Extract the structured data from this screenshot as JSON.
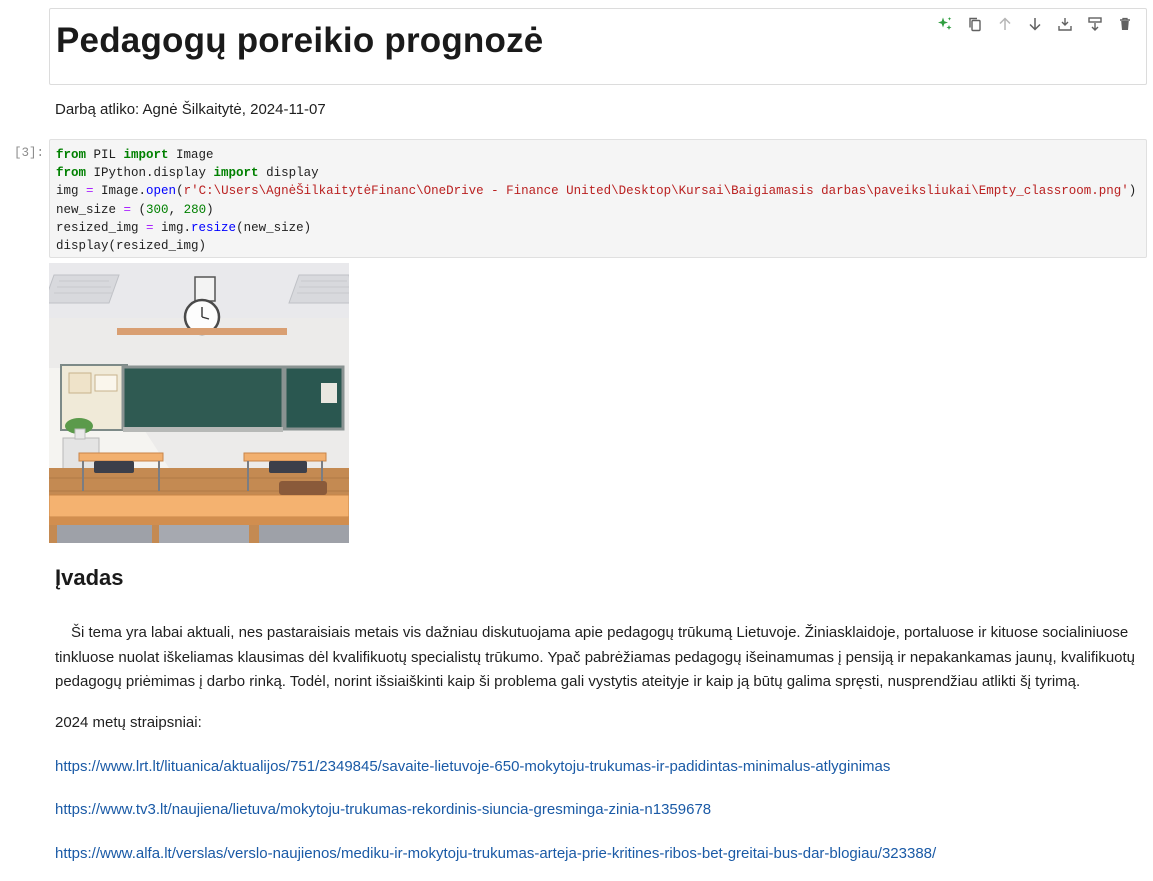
{
  "title_cell": {
    "heading": "Pedagogų poreikio prognozė",
    "toolbar": {
      "icons": [
        "sparkle-icon",
        "duplicate-icon",
        "move-up-icon",
        "move-down-icon",
        "insert-above-icon",
        "insert-below-icon",
        "delete-icon"
      ],
      "accent_color": "#2e9e3e"
    }
  },
  "author_line": "Darbą atliko: Agnė Šilkaitytė, 2024-11-07",
  "code_cell": {
    "prompt": "[3]:",
    "lines": [
      "from PIL import Image",
      "from IPython.display import display",
      "img = Image.open(r'C:\\Users\\AgnėŠilkaitytėFinanc\\OneDrive - Finance United\\Desktop\\Kursai\\Baigiamasis darbas\\paveiksliukai\\Empty_classroom.png')",
      "new_size = (300, 280)",
      "resized_img = img.resize(new_size)",
      "display(resized_img)"
    ]
  },
  "markdown": {
    "heading": "Įvadas",
    "paragraph": "Ši tema yra labai aktuali, nes pastaraisiais metais vis dažniau diskutuojama apie pedagogų trūkumą Lietuvoje. Žiniasklaidoje, portaluose ir kituose socialiniuose tinkluose nuolat iškeliamas klausimas dėl kvalifikuotų specialistų trūkumo. Ypač pabrėžiamas pedagogų išeinamumas į pensiją ir nepakankamas jaunų, kvalifikuotų pedagogų priėmimas į darbo rinką. Todėl, norint išsiaiškinti kaip ši problema gali vystytis ateityje ir kaip ją būtų galima spręsti, nusprendžiau atlikti šį tyrimą.",
    "articles_label": "2024 metų straipsniai:",
    "links": [
      "https://www.lrt.lt/lituanica/aktualijos/751/2349845/savaite-lietuvoje-650-mokytoju-trukumas-ir-padidintas-minimalus-atlyginimas",
      "https://www.tv3.lt/naujiena/lietuva/mokytoju-trukumas-rekordinis-siuncia-gresminga-zinia-n1359678",
      "https://www.alfa.lt/verslas/verslo-naujienos/mediku-ir-mokytoju-trukumas-arteja-prie-kritines-ribos-bet-greitai-bus-dar-blogiau/323388/"
    ],
    "link_color": "#1a5aa6"
  }
}
